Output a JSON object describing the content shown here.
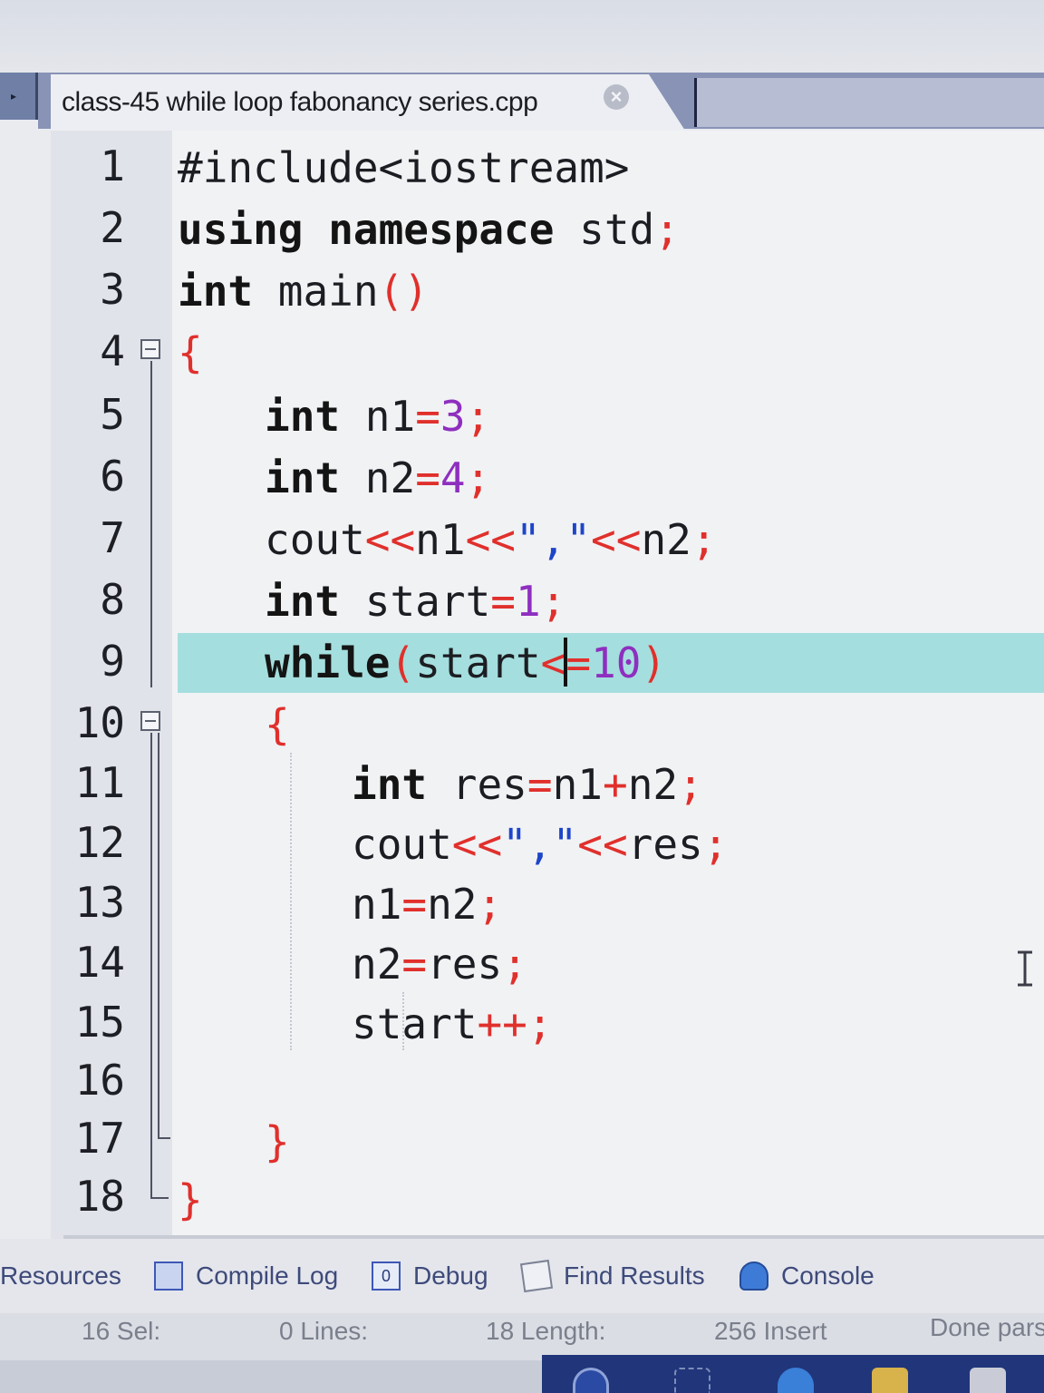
{
  "tab": {
    "title": "class-45 while loop fabonancy series.cpp"
  },
  "editor": {
    "line_numbers": [
      "1",
      "2",
      "3",
      "4",
      "5",
      "6",
      "7",
      "8",
      "9",
      "10",
      "11",
      "12",
      "13",
      "14",
      "15",
      "16",
      "17",
      "18"
    ],
    "lines": {
      "l1": {
        "text": "#include<iostream>"
      },
      "l2": {
        "kw1": "using",
        "kw2": "namespace",
        "text": "std",
        "semi": ";"
      },
      "l3": {
        "kw": "int",
        "text": "main",
        "parens": "()"
      },
      "l4": {
        "brace": "{"
      },
      "l5": {
        "kw": "int",
        "name": "n1",
        "eq": "=",
        "num": "3",
        "semi": ";"
      },
      "l6": {
        "kw": "int",
        "name": "n2",
        "eq": "=",
        "num": "4",
        "semi": ";"
      },
      "l7": {
        "a": "cout",
        "op1": "<<",
        "b": "n1",
        "op2": "<<",
        "str": "\",\"",
        "op3": "<<",
        "c": "n2",
        "semi": ";"
      },
      "l8": {
        "kw": "int",
        "name": "start",
        "eq": "=",
        "num": "1",
        "semi": ";"
      },
      "l9": {
        "kw": "while",
        "lp": "(",
        "name": "start",
        "op_a": "<",
        "op_b": "=",
        "num": "10",
        "rp": ")"
      },
      "l10": {
        "brace": "{"
      },
      "l11": {
        "kw": "int",
        "name": "res",
        "eq": "=",
        "a": "n1",
        "plus": "+",
        "b": "n2",
        "semi": ";"
      },
      "l12": {
        "a": "cout",
        "op1": "<<",
        "str": "\",\"",
        "op2": "<<",
        "b": "res",
        "semi": ";"
      },
      "l13": {
        "a": "n1",
        "eq": "=",
        "b": "n2",
        "semi": ";"
      },
      "l14": {
        "a": "n2",
        "eq": "=",
        "b": "res",
        "semi": ";"
      },
      "l15": {
        "a": "start",
        "inc": "++",
        "semi": ";"
      },
      "l17": {
        "brace": "}"
      },
      "l18": {
        "brace": "}"
      }
    }
  },
  "panel_tabs": {
    "resources": "Resources",
    "compile_log": "Compile Log",
    "debug": "Debug",
    "find_results": "Find Results",
    "console": "Console"
  },
  "status": {
    "sel": "16 Sel:",
    "lines": "0 Lines:",
    "length": "18 Length:",
    "insert": "256 Insert",
    "done": "Done pars"
  },
  "colors": {
    "current_line": "#a5dede",
    "operator": "#e0302c",
    "number": "#8e2fbf",
    "string": "#1d45c9"
  }
}
